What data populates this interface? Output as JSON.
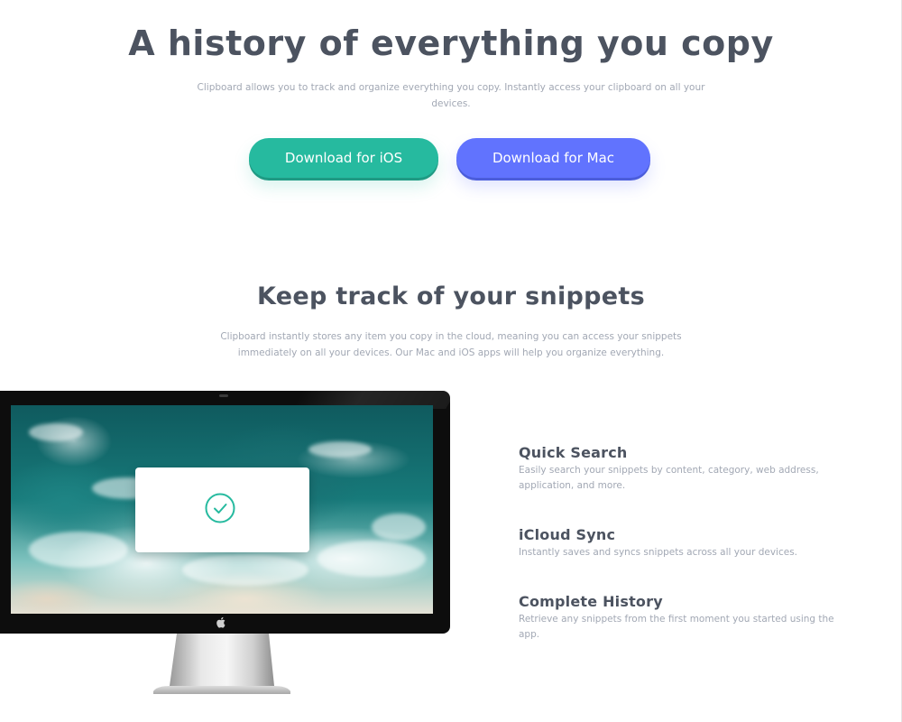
{
  "hero": {
    "title": "A history of everything you copy",
    "subtitle": "Clipboard allows you to track and organize everything you copy. Instantly access your clipboard on all your devices.",
    "buttons": {
      "ios_label": "Download for iOS",
      "mac_label": "Download for Mac"
    }
  },
  "snippets": {
    "title": "Keep track of your snippets",
    "subtitle": "Clipboard instantly stores any item you copy in the cloud, meaning you can access your snippets immediately on all your devices. Our Mac and iOS apps will help you organize everything.",
    "features": [
      {
        "title": "Quick Search",
        "description": "Easily search your snippets by content, category, web address, application, and more."
      },
      {
        "title": "iCloud Sync",
        "description": "Instantly saves and syncs snippets across all your devices."
      },
      {
        "title": "Complete History",
        "description": "Retrieve any snippets from the first moment you started using the app."
      }
    ]
  },
  "icons": {
    "check": "check-circle-icon",
    "apple": "apple-logo-icon"
  },
  "colors": {
    "heading": "#4c5360",
    "body_text": "#a2a8b4",
    "ios_button": "#26ba9f",
    "mac_button": "#6173fe"
  }
}
